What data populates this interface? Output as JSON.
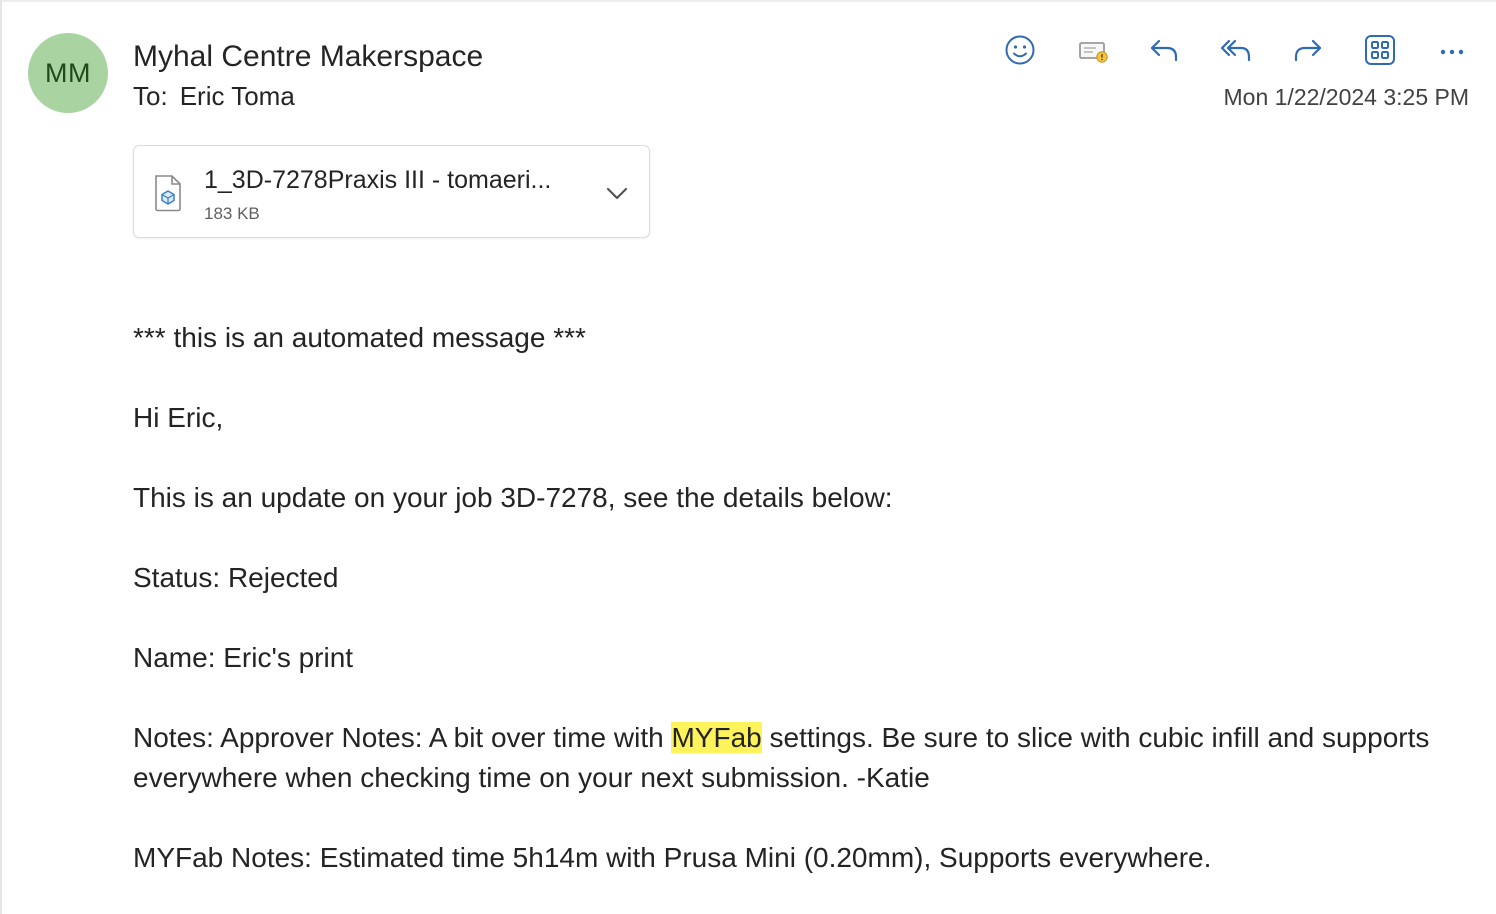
{
  "header": {
    "avatar_initials": "MM",
    "avatar_color": "#a9d3a0",
    "sender": "Myhal Centre Makerspace",
    "to_label": "To:",
    "to_name": "Eric Toma",
    "date": "Mon 1/22/2024 3:25 PM"
  },
  "toolbar": {
    "icon_color": "#2f6bb5",
    "icons": [
      "smiley-icon",
      "flag-mail-icon",
      "reply-icon",
      "reply-all-icon",
      "forward-icon",
      "apps-icon",
      "more-icon"
    ]
  },
  "attachment": {
    "name": "1_3D-7278Praxis III - tomaeri...",
    "size": "183 KB"
  },
  "message": {
    "line1": "*** this is an automated message ***",
    "greeting": "Hi Eric,",
    "intro": "This is an update on your job 3D-7278, see the details below:",
    "status": "Status: Rejected",
    "name": "Name: Eric's print",
    "notes_prefix": "Notes: Approver Notes: A bit over time with ",
    "notes_highlight": "MYFab",
    "notes_suffix": " settings. Be sure to slice with cubic infill and supports everywhere when checking time on your next submission. -Katie",
    "myfab_notes": "MYFab Notes: Estimated time 5h14m with Prusa Mini (0.20mm), Supports everywhere.",
    "highlight_color": "#fff35b"
  }
}
